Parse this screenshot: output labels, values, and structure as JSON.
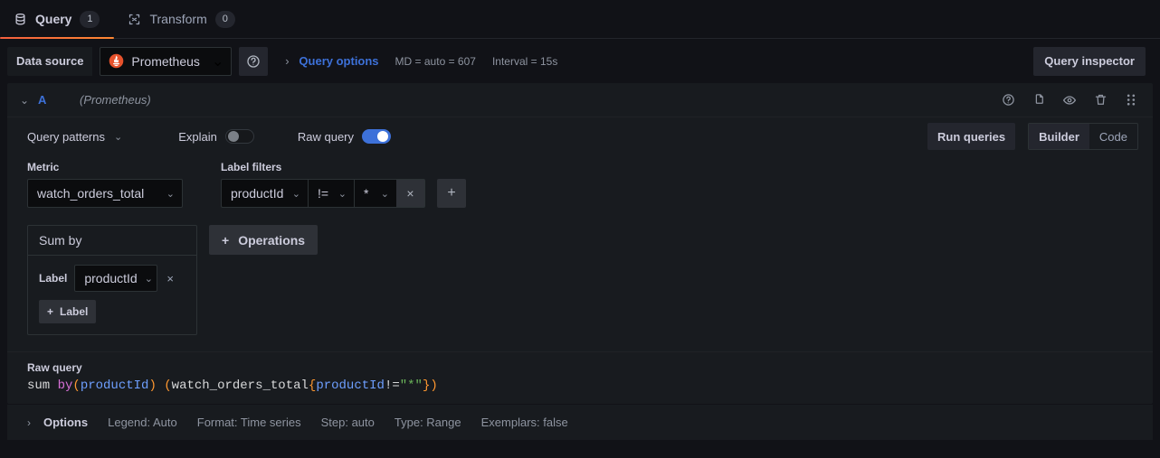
{
  "tabs": [
    {
      "label": "Query",
      "badge": "1",
      "icon": "database-icon",
      "active": true
    },
    {
      "label": "Transform",
      "badge": "0",
      "icon": "transform-icon",
      "active": false
    }
  ],
  "datasource_row": {
    "label": "Data source",
    "selected": "Prometheus",
    "logo_icon": "prometheus-logo-icon",
    "help_icon": "question-circle-icon",
    "expand_icon": "chevron-right-icon",
    "query_options_label": "Query options",
    "max_data_points": "MD = auto = 607",
    "interval": "Interval = 15s",
    "query_inspector_label": "Query inspector"
  },
  "query_row": {
    "collapse_icon": "chevron-down-icon",
    "ref_id": "A",
    "datasource_name": "(Prometheus)",
    "actions": [
      {
        "name": "help-icon",
        "glyph": "?"
      },
      {
        "name": "duplicate-icon",
        "glyph": "copy"
      },
      {
        "name": "eye-icon",
        "glyph": "eye"
      },
      {
        "name": "trash-icon",
        "glyph": "trash"
      },
      {
        "name": "drag-handle-icon",
        "glyph": "dots"
      }
    ]
  },
  "toolbar": {
    "query_patterns_label": "Query patterns",
    "explain_label": "Explain",
    "explain_on": false,
    "raw_query_label": "Raw query",
    "raw_query_on": true,
    "run_queries_label": "Run queries",
    "editor_modes": [
      "Builder",
      "Code"
    ],
    "editor_mode_selected": "Builder"
  },
  "builder": {
    "metric_label": "Metric",
    "metric_value": "watch_orders_total",
    "label_filters_label": "Label filters",
    "filter": {
      "key": "productId",
      "operator": "!=",
      "value": "*",
      "remove_label": "×",
      "add_label": "+"
    }
  },
  "operations": {
    "card_title": "Sum by",
    "label_text": "Label",
    "label_value": "productId",
    "remove_label": "×",
    "add_label_button": "Label",
    "add_label_plus": "+",
    "operations_button": "Operations",
    "operations_plus": "+"
  },
  "raw_query": {
    "label": "Raw query",
    "tokens": [
      {
        "text": "sum ",
        "type": "plain"
      },
      {
        "text": "by",
        "type": "keyword"
      },
      {
        "text": "(",
        "type": "paren"
      },
      {
        "text": "productId",
        "type": "label"
      },
      {
        "text": ")",
        "type": "paren"
      },
      {
        "text": " ",
        "type": "plain"
      },
      {
        "text": "(",
        "type": "paren"
      },
      {
        "text": "watch_orders_total",
        "type": "plain"
      },
      {
        "text": "{",
        "type": "brace"
      },
      {
        "text": "productId",
        "type": "label"
      },
      {
        "text": "!=",
        "type": "plain"
      },
      {
        "text": "\"*\"",
        "type": "string"
      },
      {
        "text": "}",
        "type": "brace"
      },
      {
        "text": ")",
        "type": "paren"
      }
    ],
    "full_text": "sum by(productId) (watch_orders_total{productId!=\"*\"})"
  },
  "options_footer": {
    "expand_icon": "chevron-right-icon",
    "title": "Options",
    "items": [
      "Legend: Auto",
      "Format: Time series",
      "Step: auto",
      "Type: Range",
      "Exemplars: false"
    ]
  },
  "colors": {
    "accent_orange": "#f55f3e",
    "link_blue": "#3d71d9",
    "toggle_blue": "#3d71d9",
    "panel_bg": "#181b1f",
    "page_bg": "#111217",
    "prometheus_red": "#e6522c"
  }
}
